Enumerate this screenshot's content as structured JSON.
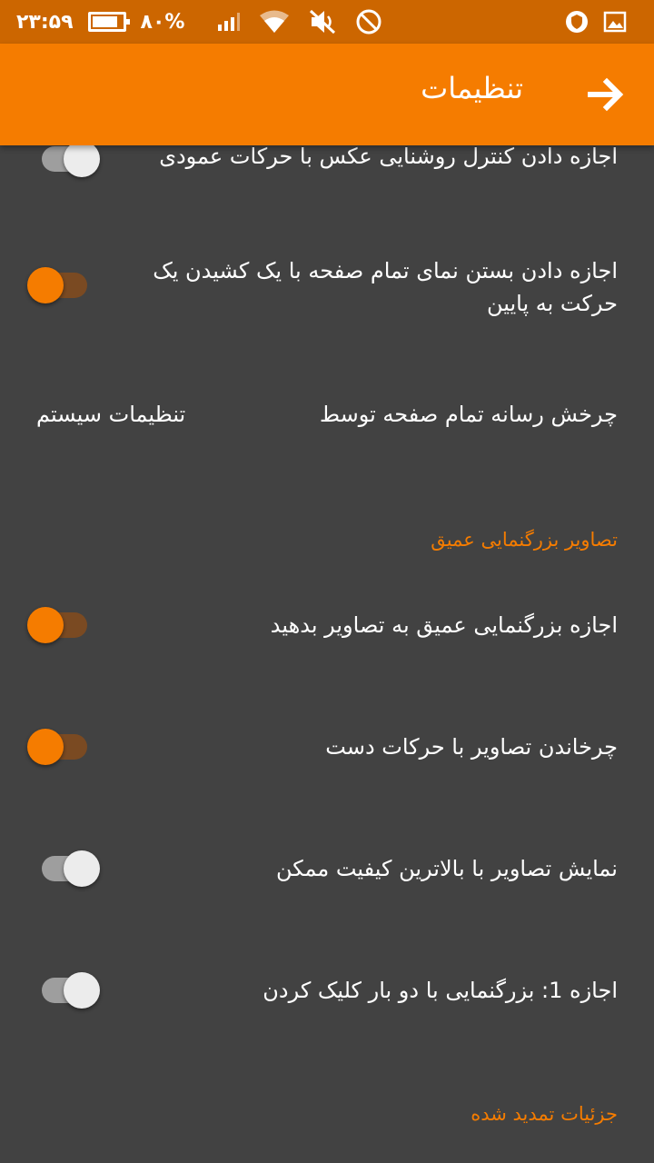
{
  "status_bar": {
    "time": "۲۳:۵۹",
    "battery_percent": "۸۰%",
    "icons": [
      "battery-icon",
      "signal-icon",
      "wifi-icon",
      "mute-icon",
      "dnd-icon",
      "vpn-shield-icon",
      "gallery-icon"
    ]
  },
  "toolbar": {
    "title": "تنظیمات",
    "back_icon": "arrow-forward-icon"
  },
  "settings": {
    "brightness": {
      "label": "اجازه دادن کنترل روشنایی عکس با حرکات عمودی",
      "enabled": false
    },
    "swipe_close": {
      "label": "اجازه دادن بستن نمای تمام صفحه با یک کشیدن یک حرکت به پایین",
      "enabled": true
    },
    "rotation": {
      "label": "چرخش رسانه تمام صفحه توسط",
      "value": "تنظیمات سیستم"
    },
    "deep_zoom_header": "تصاویر بزرگنمایی عمیق",
    "deep_zoom": {
      "label": "اجازه بزرگنمایی عمیق به تصاویر بدهید",
      "enabled": true
    },
    "rotate_gestures": {
      "label": "چرخاندن تصاویر با حرکات دست",
      "enabled": true
    },
    "highest_quality": {
      "label": "نمایش تصاویر با بالاترین کیفیت ممکن",
      "enabled": false
    },
    "double_tap_zoom": {
      "label": "اجازه 1: بزرگنمایی با دو بار کلیک کردن",
      "enabled": false
    },
    "extended_details_header": "جزئیات تمدید شده"
  },
  "colors": {
    "accent": "#f57c00",
    "status_bar": "#cc6600",
    "background": "#424242"
  }
}
